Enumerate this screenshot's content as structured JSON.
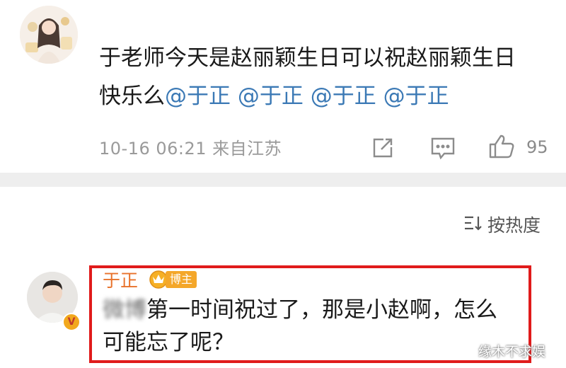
{
  "post": {
    "text_line1": "于老师今天是赵丽颖生日可以祝赵丽颖生日",
    "text_line2_prefix": "快乐么",
    "mentions": [
      "@于正",
      "@于正",
      "@于正",
      "@于正"
    ],
    "timestamp": "10-16 06:21",
    "location": "来自江苏",
    "like_count": "95",
    "icons": [
      "share-icon",
      "comment-icon",
      "like-icon"
    ]
  },
  "sort": {
    "label": "按热度",
    "icon": "sort-icon"
  },
  "comment": {
    "author": "于正",
    "badge": "博主",
    "blurred_prefix": "微博",
    "text_line1": "第一时间祝过了，那是小赵啊，怎么",
    "text_line2": "可能忘了呢？"
  },
  "watermark": "缘木不求娱",
  "colors": {
    "mention": "#3b79b5",
    "author": "#e8722b",
    "badge": "#f4a72a",
    "highlight": "#e01b1b"
  }
}
